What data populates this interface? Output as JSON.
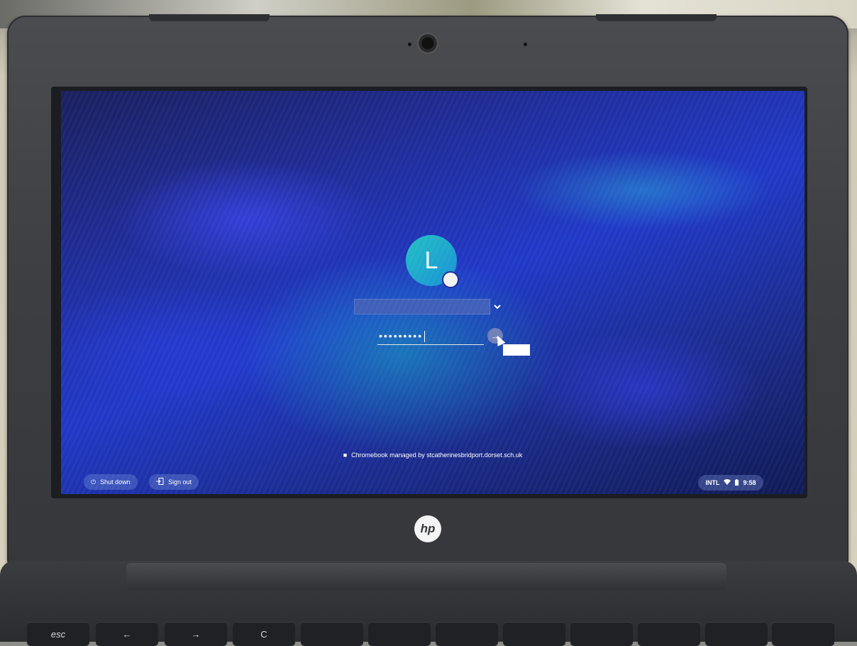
{
  "login": {
    "avatar_initial": "L",
    "username_value": "",
    "dropdown_icon": "chevron-down-icon",
    "password_masked": "•••••••••",
    "submit_icon": "arrow-right-icon"
  },
  "footer": {
    "managed_note": "Chromebook managed by stcatherinesbridport.dorset.sch.uk",
    "managed_icon": "building-icon"
  },
  "shelf": {
    "shutdown_label": "Shut down",
    "shutdown_icon": "power-icon",
    "signout_label": "Sign out",
    "signout_icon": "sign-out-icon"
  },
  "status": {
    "input_method": "INTL",
    "wifi_icon": "wifi-icon",
    "battery_icon": "battery-icon",
    "time": "9:58"
  },
  "device": {
    "brand_logo": "hp"
  },
  "keyboard": {
    "keys": [
      "esc",
      "←",
      "→",
      "C",
      "",
      "",
      "",
      "",
      "",
      "",
      "",
      ""
    ]
  },
  "colors": {
    "avatar_gradient_start": "#21c1c2",
    "avatar_gradient_end": "#1a8fd8",
    "wallpaper_blue": "#2038c8"
  }
}
